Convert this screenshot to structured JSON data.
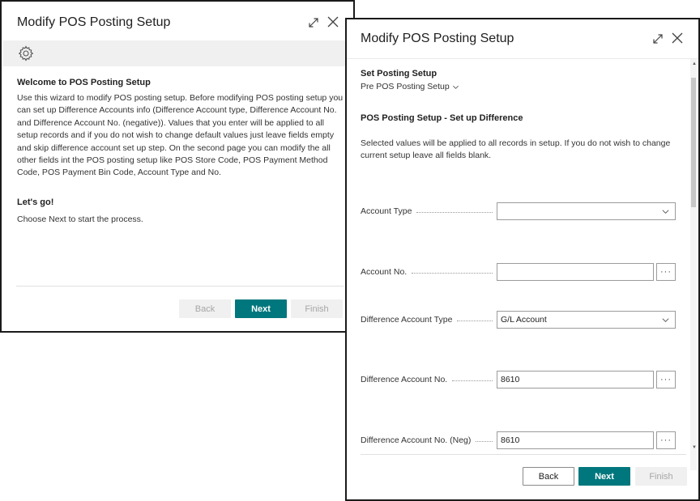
{
  "colors": {
    "accent": "#00777d",
    "border": "#1a1a1a",
    "band": "#f0f0f0",
    "disabled_text": "#a6a6a6"
  },
  "dialog1": {
    "title": "Modify POS Posting Setup",
    "icons": {
      "expand": "expand-icon",
      "close": "close-icon",
      "band": "gear-icon"
    },
    "welcome_heading": "Welcome to POS Posting Setup",
    "welcome_text": "Use this wizard to modify POS posting setup. Before modifying POS posting setup you can set up Difference Accounts info (Difference Account type, Difference Account No. and Difference Account No. (negative)). Values that you enter will be applied to all setup records and if you do not wish to change default values just leave fields empty and skip difference account set up step. On the second page you can modify the all other fields int the POS posting setup like POS Store Code, POS Payment Method Code, POS Payment Bin Code, Account Type and No.",
    "letsgo_heading": "Let's go!",
    "letsgo_text": "Choose Next to start the process.",
    "buttons": {
      "back": "Back",
      "next": "Next",
      "finish": "Finish"
    }
  },
  "dialog2": {
    "title": "Modify POS Posting Setup",
    "icons": {
      "expand": "expand-icon",
      "close": "close-icon"
    },
    "set_posting_heading": "Set Posting Setup",
    "pre_setup_label": "Pre POS Posting Setup",
    "difference_heading": "POS Posting Setup - Set up Difference",
    "difference_text": "Selected values will be applied to all records in setup. If you do not wish to change current setup leave all fields blank.",
    "fields": {
      "account_type": {
        "label": "Account Type",
        "value": ""
      },
      "account_no": {
        "label": "Account No.",
        "value": "",
        "lookup": "···"
      },
      "diff_account_type": {
        "label": "Difference Account Type",
        "value": "G/L Account"
      },
      "diff_account_no": {
        "label": "Difference Account No.",
        "value": "8610",
        "lookup": "···"
      },
      "diff_account_no_neg": {
        "label": "Difference Account No. (Neg)",
        "value": "8610",
        "lookup": "···"
      }
    },
    "scroll": {
      "up": "▲",
      "down": "▼"
    },
    "buttons": {
      "back": "Back",
      "next": "Next",
      "finish": "Finish"
    }
  }
}
